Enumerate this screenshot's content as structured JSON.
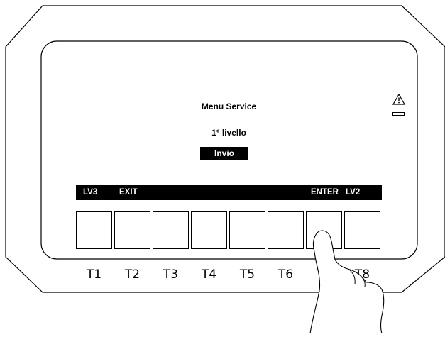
{
  "screen": {
    "title": "Menu Service",
    "level": "1° livello",
    "selected_item": "Invio"
  },
  "softkeys": {
    "lv3": "LV3",
    "exit": "EXIT",
    "enter": "ENTER",
    "lv2": "LV2"
  },
  "keys": [
    {
      "label": "T1"
    },
    {
      "label": "T2"
    },
    {
      "label": "T3"
    },
    {
      "label": "T4"
    },
    {
      "label": "T5"
    },
    {
      "label": "T6"
    },
    {
      "label": "T7"
    },
    {
      "label": "T8"
    }
  ],
  "indicators": {
    "warning_icon": "warning-triangle-icon",
    "status_led": "led-indicator"
  }
}
